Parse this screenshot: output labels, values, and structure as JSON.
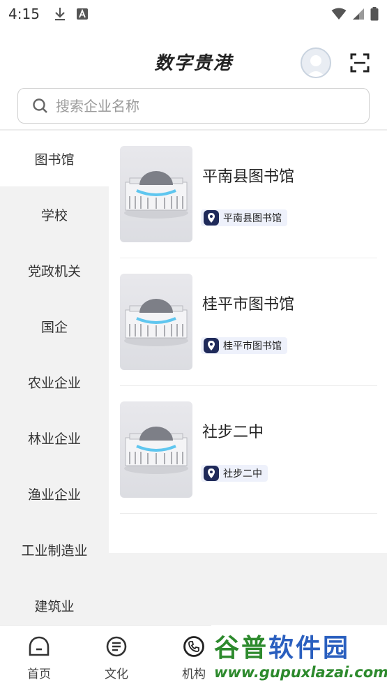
{
  "status_bar": {
    "time": "4:15"
  },
  "header": {
    "title": "数字贵港"
  },
  "search": {
    "placeholder": "搜索企业名称"
  },
  "sidebar": {
    "items": [
      {
        "label": "图书馆",
        "active": true
      },
      {
        "label": "学校"
      },
      {
        "label": "党政机关"
      },
      {
        "label": "国企"
      },
      {
        "label": "农业企业"
      },
      {
        "label": "林业企业"
      },
      {
        "label": "渔业企业"
      },
      {
        "label": "工业制造业"
      },
      {
        "label": "建筑业"
      }
    ]
  },
  "list": {
    "items": [
      {
        "title": "平南县图书馆",
        "tag": "平南县图书馆"
      },
      {
        "title": "桂平市图书馆",
        "tag": "桂平市图书馆"
      },
      {
        "title": "社步二中",
        "tag": "社步二中"
      }
    ]
  },
  "bottom_nav": {
    "items": [
      {
        "label": "首页",
        "icon": "home-icon"
      },
      {
        "label": "文化",
        "icon": "document-icon"
      },
      {
        "label": "机构",
        "icon": "phone-icon"
      }
    ]
  },
  "watermark": {
    "cn_green": "谷普",
    "cn_blue": "软件园",
    "url": "www.gupuxlazai.com"
  },
  "colors": {
    "accent": "#1f2a5a",
    "tag_bg": "#eef1fb",
    "sidebar_bg": "#f2f2f2"
  }
}
